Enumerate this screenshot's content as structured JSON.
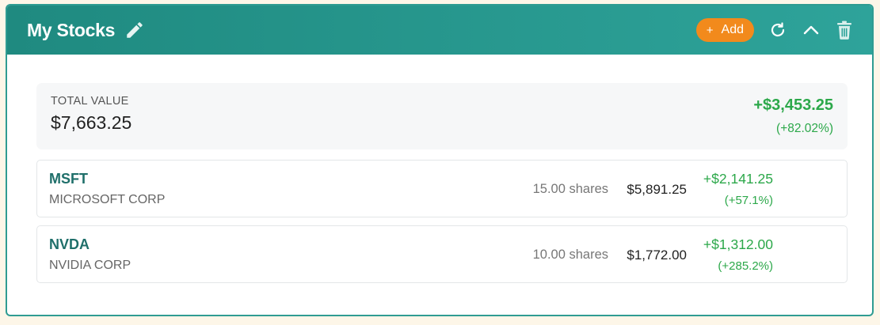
{
  "widget": {
    "title": "My Stocks",
    "add_label": "Add",
    "add_plus": "+",
    "accent_color": "#2ea39a",
    "add_color": "#f28a1c",
    "icons": [
      "pencil-icon",
      "refresh-icon",
      "chevron-up-icon",
      "trash-icon"
    ]
  },
  "summary": {
    "label": "TOTAL VALUE",
    "value": "$7,663.25",
    "gain": "+$3,453.25",
    "gain_pct": "(+82.02%)",
    "gain_color": "#2ca84a"
  },
  "stocks": [
    {
      "symbol": "MSFT",
      "name": "MICROSOFT CORP",
      "shares": "15.00 shares",
      "value": "$5,891.25",
      "gain": "+$2,141.25",
      "gain_pct": "(+57.1%)"
    },
    {
      "symbol": "NVDA",
      "name": "NVIDIA CORP",
      "shares": "10.00 shares",
      "value": "$1,772.00",
      "gain": "+$1,312.00",
      "gain_pct": "(+285.2%)"
    }
  ]
}
